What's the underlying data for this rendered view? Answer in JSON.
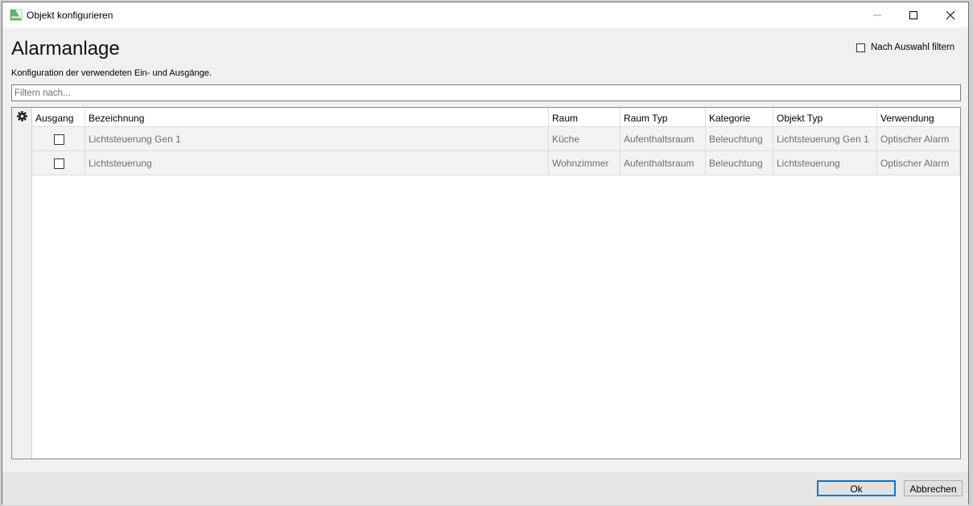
{
  "window": {
    "title": "Objekt konfigurieren"
  },
  "header": {
    "title": "Alarmanlage",
    "subtitle": "Konfiguration der verwendeten Ein- und Ausgänge.",
    "filter_selection_label": "Nach Auswahl filtern",
    "filter_selection_checked": false
  },
  "search": {
    "placeholder": "Filtern nach..."
  },
  "table": {
    "columns": [
      "Ausgang",
      "Bezeichnung",
      "Raum",
      "Raum Typ",
      "Kategorie",
      "Objekt Typ",
      "Verwendung"
    ],
    "rows": [
      {
        "ausgang": false,
        "bezeichnung": "Lichtsteuerung Gen 1",
        "raum": "Küche",
        "raum_typ": "Aufenthaltsraum",
        "kategorie": "Beleuchtung",
        "objekt_typ": "Lichtsteuerung Gen 1",
        "verwendung": "Optischer Alarm"
      },
      {
        "ausgang": false,
        "bezeichnung": "Lichtsteuerung",
        "raum": "Wohnzimmer",
        "raum_typ": "Aufenthaltsraum",
        "kategorie": "Beleuchtung",
        "objekt_typ": "Lichtsteuerung",
        "verwendung": "Optischer Alarm"
      }
    ]
  },
  "buttons": {
    "ok": "Ok",
    "cancel": "Abbrechen"
  },
  "icons": {
    "app": "app-icon",
    "settings": "gear-icon",
    "minimize": "minimize-icon",
    "maximize": "maximize-icon",
    "close": "close-icon"
  },
  "colors": {
    "accent": "#0078d7",
    "app_icon_green": "#5cb85c"
  }
}
